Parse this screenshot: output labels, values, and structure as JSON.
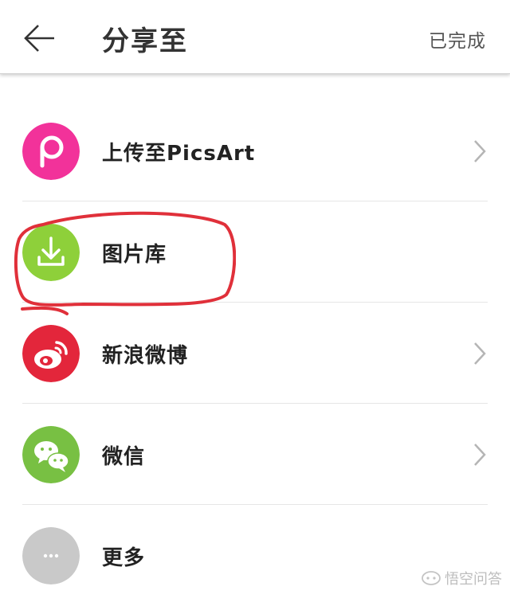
{
  "header": {
    "title": "分享至",
    "done_label": "已完成"
  },
  "items": [
    {
      "label": "上传至PicsArt",
      "icon": "picsart-icon",
      "color": "#f2329a",
      "chevron": true
    },
    {
      "label": "图片库",
      "icon": "download-icon",
      "color": "#8ed03a",
      "chevron": false
    },
    {
      "label": "新浪微博",
      "icon": "weibo-icon",
      "color": "#e3263b",
      "chevron": true
    },
    {
      "label": "微信",
      "icon": "wechat-icon",
      "color": "#78c043",
      "chevron": true
    },
    {
      "label": "更多",
      "icon": "more-icon",
      "color": "#c9c9c9",
      "chevron": false
    }
  ],
  "watermark": {
    "text": "悟空问答"
  },
  "colors": {
    "annotation_circle": "#e0303a"
  }
}
